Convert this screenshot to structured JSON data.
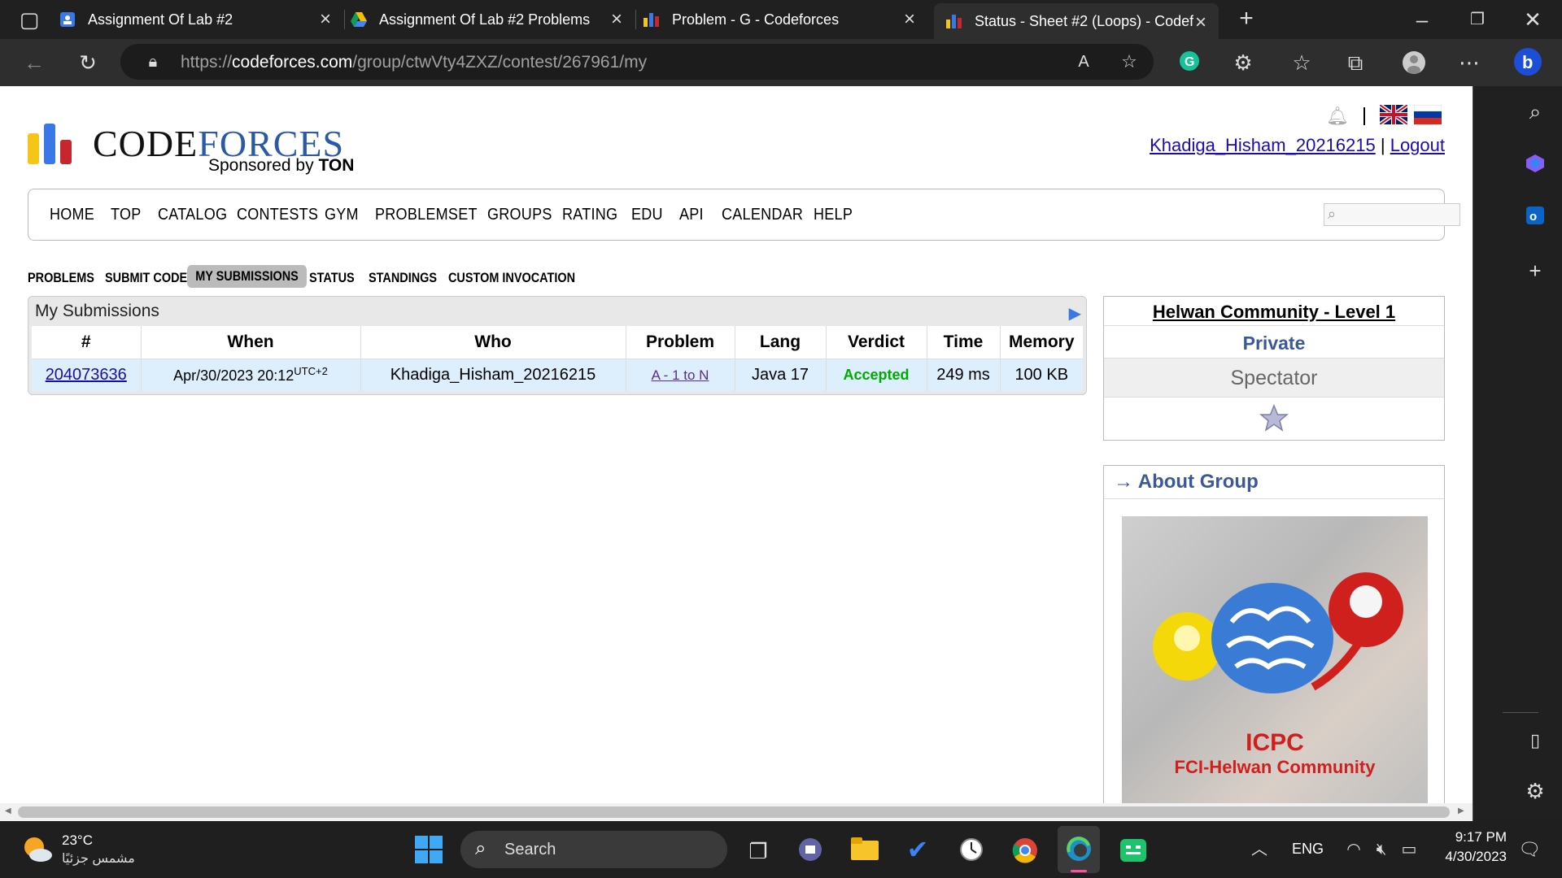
{
  "browser": {
    "tabs": [
      {
        "title": "Assignment Of Lab #2",
        "icon": "docs-icon"
      },
      {
        "title": "Assignment Of Lab #2 Problems",
        "icon": "drive-icon"
      },
      {
        "title": "Problem - G - Codeforces",
        "icon": "codeforces-icon"
      },
      {
        "title": "Status - Sheet #2 (Loops) - Codef",
        "icon": "codeforces-icon"
      }
    ],
    "url_prefix": "https://",
    "url_domain": "codeforces.com",
    "url_path": "/group/ctwVty4ZXZ/contest/267961/my"
  },
  "site": {
    "logo_code": "CODE",
    "logo_forces": "FORCES",
    "sponsor_text": "Sponsored by",
    "sponsor_brand": "TON",
    "username": "Khadiga_Hisham_20216215",
    "separator": "|",
    "logout": "Logout",
    "nav": [
      "HOME",
      "TOP",
      "CATALOG",
      "CONTESTS",
      "GYM",
      "PROBLEMSET",
      "GROUPS",
      "RATING",
      "EDU",
      "API",
      "CALENDAR",
      "HELP"
    ],
    "subnav": [
      "PROBLEMS",
      "SUBMIT CODE",
      "MY SUBMISSIONS",
      "STATUS",
      "STANDINGS",
      "CUSTOM INVOCATION"
    ]
  },
  "submissions": {
    "title": "My Submissions",
    "headers": [
      "#",
      "When",
      "Who",
      "Problem",
      "Lang",
      "Verdict",
      "Time",
      "Memory"
    ],
    "row": {
      "id": "204073636",
      "when": "Apr/30/2023 20:12",
      "tz": "UTC+2",
      "who": "Khadiga_Hisham_20216215",
      "problem": "A - 1 to N",
      "lang": "Java 17",
      "verdict": "Accepted",
      "time": "249 ms",
      "memory": "100 KB"
    }
  },
  "group": {
    "name": "Helwan Community - Level 1",
    "privacy": "Private",
    "role": "Spectator",
    "about_arrow": "→",
    "about": "About Group",
    "img_title": "ICPC",
    "img_subtitle": "FCI-Helwan Community"
  },
  "taskbar": {
    "temp": "23°C",
    "weather": "مشمس جزئيًا",
    "search": "Search",
    "lang": "ENG",
    "time": "9:17 PM",
    "date": "4/30/2023"
  },
  "colors": {
    "accepted": "#0a0",
    "link": "#1a0dab",
    "cf_blue": "#2a5aa5",
    "cf_yellow": "#f5c518",
    "cf_red": "#c6262e"
  }
}
